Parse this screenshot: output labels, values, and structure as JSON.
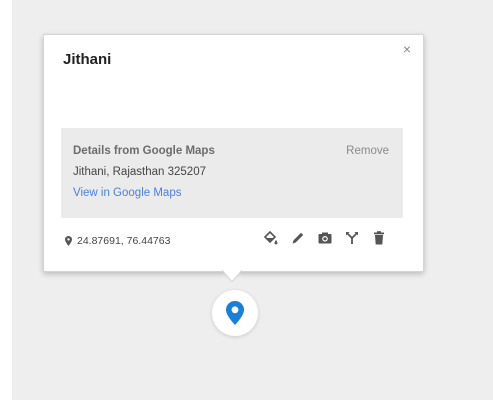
{
  "info_window": {
    "title": "Jithani",
    "close_label": "×",
    "details": {
      "heading": "Details from Google Maps",
      "remove_label": "Remove",
      "address": "Jithani, Rajasthan 325207",
      "link_label": "View in Google Maps"
    },
    "coordinates": "24.87691, 76.44763",
    "toolbar": [
      "paint-bucket-icon",
      "pencil-icon",
      "camera-icon",
      "directions-fork-icon",
      "trash-icon"
    ]
  },
  "colors": {
    "map_background": "#efeeee",
    "link": "#4a7fe0",
    "marker": "#1a7fd6",
    "icon": "#555555"
  }
}
